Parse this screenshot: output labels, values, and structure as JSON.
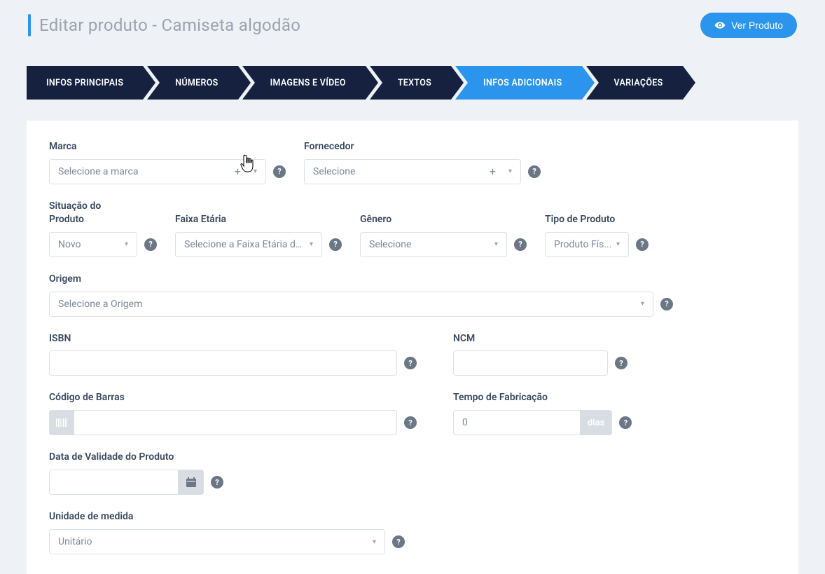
{
  "header": {
    "title": "Editar produto - Camiseta algodão",
    "view_button": "Ver Produto"
  },
  "steps": [
    {
      "label": "INFOS PRINCIPAIS",
      "active": false
    },
    {
      "label": "NÚMEROS",
      "active": false
    },
    {
      "label": "IMAGENS E VÍDEO",
      "active": false
    },
    {
      "label": "TEXTOS",
      "active": false
    },
    {
      "label": "INFOS ADICIONAIS",
      "active": true
    },
    {
      "label": "VARIAÇÕES",
      "active": false
    }
  ],
  "form": {
    "marca": {
      "label": "Marca",
      "placeholder": "Selecione a marca"
    },
    "fornecedor": {
      "label": "Fornecedor",
      "placeholder": "Selecione"
    },
    "situacao": {
      "label": "Situação do Produto",
      "value": "Novo"
    },
    "faixa": {
      "label": "Faixa Etária",
      "placeholder": "Selecione a Faixa Etária do..."
    },
    "genero": {
      "label": "Gênero",
      "placeholder": "Selecione"
    },
    "tipo": {
      "label": "Tipo de Produto",
      "value": "Produto Fís..."
    },
    "origem": {
      "label": "Origem",
      "placeholder": "Selecione a Origem"
    },
    "isbn": {
      "label": "ISBN"
    },
    "ncm": {
      "label": "NCM"
    },
    "codigo_barras": {
      "label": "Código de Barras"
    },
    "tempo_fab": {
      "label": "Tempo de Fabricação",
      "value": "0",
      "unit": "dias"
    },
    "validade": {
      "label": "Data de Validade do Produto"
    },
    "unidade": {
      "label": "Unidade de medida",
      "value": "Unitário"
    }
  }
}
